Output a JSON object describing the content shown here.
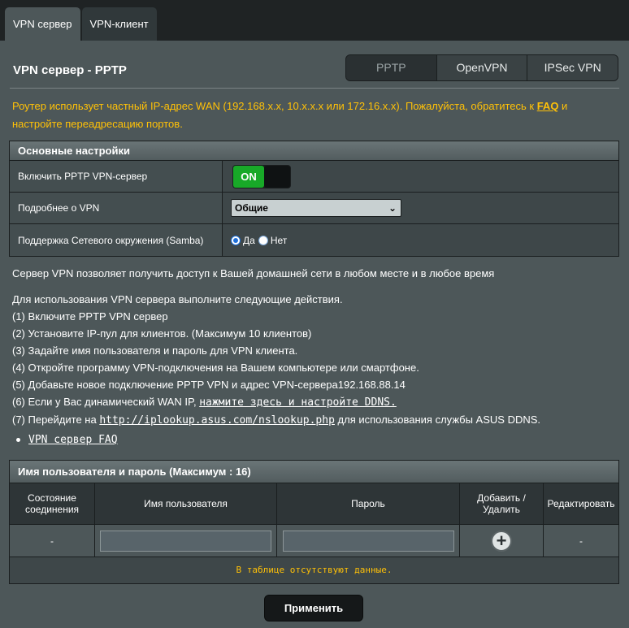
{
  "tabs": [
    {
      "label": "VPN сервер",
      "active": true
    },
    {
      "label": "VPN-клиент",
      "active": false
    }
  ],
  "page_title": "VPN сервер - PPTP",
  "protocols": [
    {
      "label": "PPTP",
      "selected": true
    },
    {
      "label": "OpenVPN",
      "selected": false
    },
    {
      "label": "IPSec VPN",
      "selected": false
    }
  ],
  "warning": {
    "text": "Роутер использует частный IP-адрес WAN (192.168.x.x, 10.x.x.x или 172.16.x.x). Пожалуйста, обратитесь к ",
    "link": "FAQ",
    "text_after": " и настройте переадресацию портов."
  },
  "basic": {
    "header": "Основные настройки",
    "enable_label": "Включить PPTP VPN-сервер",
    "toggle_label": "ON",
    "details_label": "Подробнее о VPN",
    "details_value": "Общие",
    "samba_label": "Поддержка Сетевого окружения (Samba)",
    "samba_yes": "Да",
    "samba_no": "Нет",
    "samba_selected": "yes"
  },
  "intro": "Сервер VPN позволяет получить доступ к Вашей домашней сети в любом месте и в любое время",
  "steps": {
    "title": "Для использования VPN сервера выполните следующие действия.",
    "s1": "(1) Включите PPTP VPN сервер",
    "s2": "(2) Установите IP-пул для клиентов. (Максимум 10 клиентов)",
    "s3": "(3) Задайте имя пользователя и пароль для VPN клиента.",
    "s4": "(4) Откройте программу VPN-подключения на Вашем компьютере или смартфоне.",
    "s5": "(5) Добавьте новое подключение PPTP VPN и адрес VPN-сервера192.168.88.14",
    "s6_text": "(6) Если у Вас динамический WAN IP, ",
    "s6_link": "нажмите здесь и настройте DDNS.",
    "s7_text": "(7) Перейдите на ",
    "s7_link": "http://iplookup.asus.com/nslookup.php",
    "s7_after": " для использования службы ASUS DDNS."
  },
  "faq_link": "VPN сервер FAQ",
  "users": {
    "header": "Имя пользователя и пароль (Максимум : 16)",
    "col_status": "Состояние соединения",
    "col_username": "Имя пользователя",
    "col_password": "Пароль",
    "col_add": "Добавить / Удалить",
    "col_edit": "Редактировать",
    "row_status": "-",
    "row_edit": "-",
    "no_data": "В таблице отсутствуют данные."
  },
  "apply_label": "Применить",
  "colors": {
    "warning": "#ffc107",
    "toggle_on": "#18a928",
    "panel": "#4d5759",
    "background": "#1f2324"
  }
}
